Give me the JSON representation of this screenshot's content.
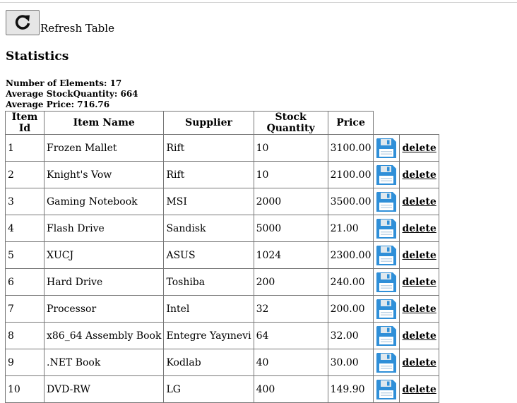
{
  "toolbar": {
    "refresh_label": "Refresh Table",
    "refresh_icon": "refresh-icon"
  },
  "statistics": {
    "title": "Statistics",
    "number_of_elements": "Number of Elements: 17",
    "average_stock": "Average StockQuantity: 664",
    "average_price": "Average Price: 716.76"
  },
  "table": {
    "headers": [
      "Item Id",
      "Item Name",
      "Supplier",
      "Stock Quantity",
      "Price"
    ],
    "delete_label": "delete",
    "save_icon": "save-icon",
    "rows": [
      [
        "1",
        "Frozen Mallet",
        "Rift",
        "10",
        "3100.00"
      ],
      [
        "2",
        "Knight's Vow",
        "Rift",
        "10",
        "2100.00"
      ],
      [
        "3",
        "Gaming Notebook",
        "MSI",
        "2000",
        "3500.00"
      ],
      [
        "4",
        "Flash Drive",
        "Sandisk",
        "5000",
        "21.00"
      ],
      [
        "5",
        "XUCJ",
        "ASUS",
        "1024",
        "2300.00"
      ],
      [
        "6",
        "Hard Drive",
        "Toshiba",
        "200",
        "240.00"
      ],
      [
        "7",
        "Processor",
        "Intel",
        "32",
        "200.00"
      ],
      [
        "8",
        "x86_64 Assembly Book",
        "Entegre Yayınevi",
        "64",
        "32.00"
      ],
      [
        "9",
        ".NET Book",
        "Kodlab",
        "40",
        "30.00"
      ],
      [
        "10",
        "DVD-RW",
        "LG",
        "400",
        "149.90"
      ]
    ]
  },
  "colors": {
    "save_icon_blue": "#2f8fd8",
    "border": "#777777"
  }
}
